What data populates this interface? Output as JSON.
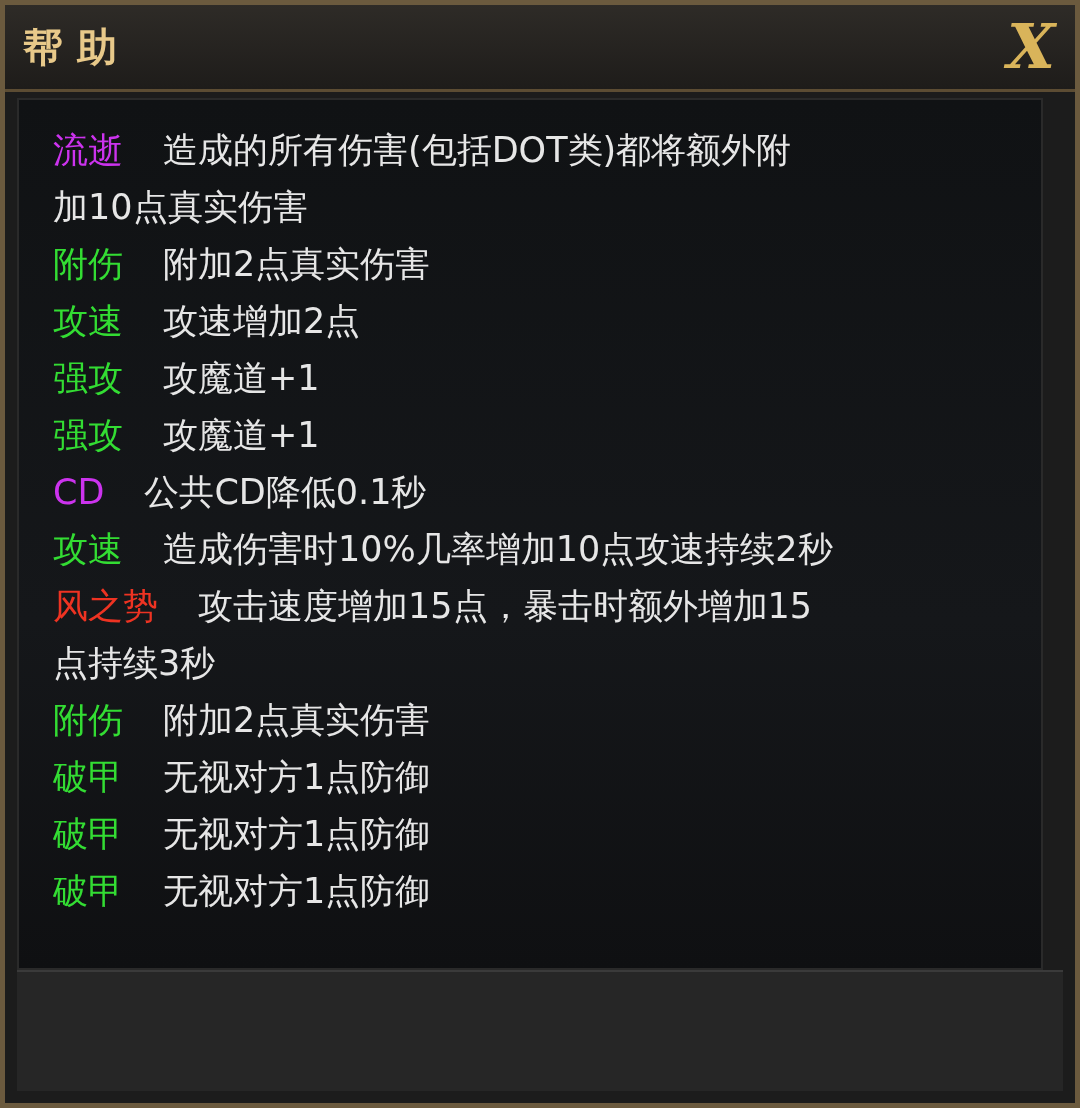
{
  "window": {
    "title": "帮 助",
    "close_icon": "X"
  },
  "effects": [
    {
      "name": "流逝",
      "color": "#cc33ee",
      "lines": [
        "造成的所有伤害(包括DOT类)都将额外附",
        "加10点真实伤害"
      ]
    },
    {
      "name": "附伤",
      "color": "#33dd33",
      "lines": [
        "附加2点真实伤害"
      ]
    },
    {
      "name": "攻速",
      "color": "#33dd33",
      "lines": [
        "攻速增加2点"
      ]
    },
    {
      "name": "强攻",
      "color": "#33dd33",
      "lines": [
        "攻魔道+1"
      ]
    },
    {
      "name": "强攻",
      "color": "#33dd33",
      "lines": [
        "攻魔道+1"
      ]
    },
    {
      "name": "CD",
      "color": "#cc33ee",
      "lines": [
        "公共CD降低0.1秒"
      ]
    },
    {
      "name": "攻速",
      "color": "#33dd33",
      "lines": [
        "造成伤害时10%几率增加10点攻速持续2秒"
      ]
    },
    {
      "name": "风之势",
      "color": "#ee3322",
      "lines": [
        "攻击速度增加15点，暴击时额外增加15",
        "点持续3秒"
      ]
    },
    {
      "name": "附伤",
      "color": "#33dd33",
      "lines": [
        "附加2点真实伤害"
      ]
    },
    {
      "name": "破甲",
      "color": "#33dd33",
      "lines": [
        "无视对方1点防御"
      ]
    },
    {
      "name": "破甲",
      "color": "#33dd33",
      "lines": [
        "无视对方1点防御"
      ]
    },
    {
      "name": "破甲",
      "color": "#33dd33",
      "lines": [
        "无视对方1点防御"
      ]
    }
  ]
}
